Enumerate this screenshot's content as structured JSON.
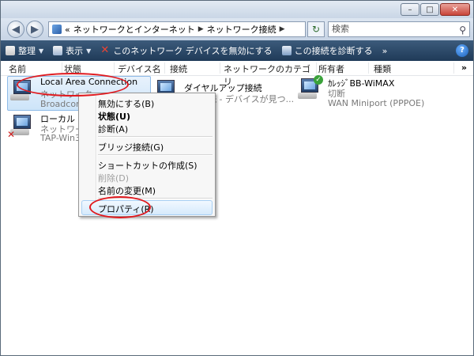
{
  "address": {
    "prefix": "«",
    "crumbs": [
      "ネットワークとインターネット",
      "ネットワーク接続"
    ],
    "search_placeholder": "検索"
  },
  "toolbar": {
    "organize": "整理",
    "view": "表示",
    "disable": "このネットワーク デバイスを無効にする",
    "diagnose": "この接続を診断する",
    "overflow": "»"
  },
  "columns": [
    "名前",
    "状態",
    "デバイス名",
    "接続",
    "ネットワークのカテゴリ",
    "所有者",
    "種類"
  ],
  "columns_more": "»",
  "connections": [
    {
      "name": "Local Area Connection",
      "status": "ネットワーク",
      "device": "Broadcom"
    },
    {
      "name": "ローカル エ",
      "status": "ネットワーク",
      "device": "TAP-Win32"
    },
    {
      "name": "ダイヤルアップ接続",
      "status": "続 - デバイスが見つ..."
    },
    {
      "name": "ｶﾚｯｼﾞBB-WiMAX",
      "status": "切断",
      "device": "WAN Miniport (PPPOE)"
    }
  ],
  "context_menu": {
    "items": [
      "無効にする(B)",
      "状態(U)",
      "診断(A)",
      "ブリッジ接続(G)",
      "ショートカットの作成(S)",
      "削除(D)",
      "名前の変更(M)",
      "プロパティ(R)"
    ]
  },
  "colors": {
    "toolbar": "#2a4766",
    "annotation": "#e0191e",
    "menu_highlight": "#d6eafc"
  }
}
